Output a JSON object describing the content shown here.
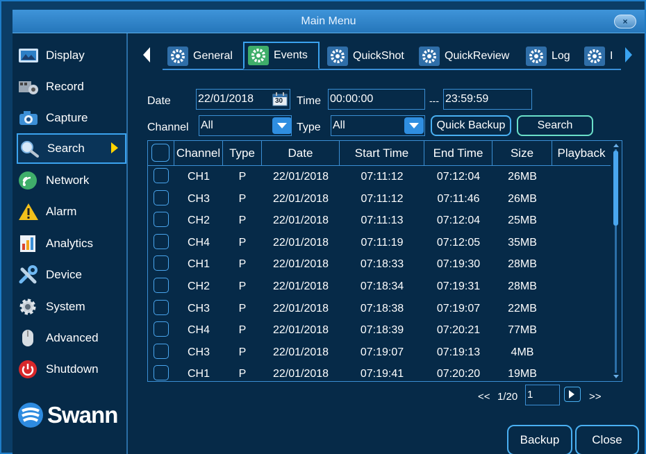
{
  "window": {
    "title": "Main Menu",
    "close_symbol": "×"
  },
  "sidebar": {
    "items": [
      {
        "label": "Display",
        "icon": "display-icon"
      },
      {
        "label": "Record",
        "icon": "record-icon"
      },
      {
        "label": "Capture",
        "icon": "camera-icon"
      },
      {
        "label": "Search",
        "icon": "search-icon",
        "active": true
      },
      {
        "label": "Network",
        "icon": "network-icon"
      },
      {
        "label": "Alarm",
        "icon": "alarm-icon"
      },
      {
        "label": "Analytics",
        "icon": "analytics-icon"
      },
      {
        "label": "Device",
        "icon": "device-icon"
      },
      {
        "label": "System",
        "icon": "system-icon"
      },
      {
        "label": "Advanced",
        "icon": "advanced-icon"
      },
      {
        "label": "Shutdown",
        "icon": "shutdown-icon"
      }
    ],
    "logo": "Swann"
  },
  "tabs": [
    {
      "label": "General"
    },
    {
      "label": "Events",
      "active": true
    },
    {
      "label": "QuickShot"
    },
    {
      "label": "QuickReview"
    },
    {
      "label": "Log"
    },
    {
      "label": "I"
    }
  ],
  "filters": {
    "date_label": "Date",
    "date_value": "22/01/2018",
    "calendar_day": "30",
    "time_label": "Time",
    "time_start": "00:00:00",
    "time_separator": "---",
    "time_end": "23:59:59",
    "channel_label": "Channel",
    "channel_value": "All",
    "type_label": "Type",
    "type_value": "All",
    "quick_backup_label": "Quick Backup",
    "search_label": "Search"
  },
  "table": {
    "headers": [
      "Channel",
      "Type",
      "Date",
      "Start Time",
      "End Time",
      "Size",
      "Playback"
    ],
    "rows": [
      [
        "CH1",
        "P",
        "22/01/2018",
        "07:11:12",
        "07:12:04",
        "26MB"
      ],
      [
        "CH3",
        "P",
        "22/01/2018",
        "07:11:12",
        "07:11:46",
        "26MB"
      ],
      [
        "CH2",
        "P",
        "22/01/2018",
        "07:11:13",
        "07:12:04",
        "25MB"
      ],
      [
        "CH4",
        "P",
        "22/01/2018",
        "07:11:19",
        "07:12:05",
        "35MB"
      ],
      [
        "CH1",
        "P",
        "22/01/2018",
        "07:18:33",
        "07:19:30",
        "28MB"
      ],
      [
        "CH2",
        "P",
        "22/01/2018",
        "07:18:34",
        "07:19:31",
        "28MB"
      ],
      [
        "CH3",
        "P",
        "22/01/2018",
        "07:18:38",
        "07:19:07",
        "22MB"
      ],
      [
        "CH4",
        "P",
        "22/01/2018",
        "07:18:39",
        "07:20:21",
        "77MB"
      ],
      [
        "CH3",
        "P",
        "22/01/2018",
        "07:19:07",
        "07:19:13",
        "4MB"
      ],
      [
        "CH1",
        "P",
        "22/01/2018",
        "07:19:41",
        "07:20:20",
        "19MB"
      ]
    ]
  },
  "pager": {
    "prev": "<<",
    "page_info": "1/20",
    "page_input": "1",
    "next": ">>"
  },
  "footer": {
    "backup_label": "Backup",
    "close_label": "Close"
  },
  "colors": {
    "accent": "#3ba3ef",
    "background": "#062a48",
    "titlebar": "#2f86cc",
    "selection_arrow": "#ffd400"
  }
}
